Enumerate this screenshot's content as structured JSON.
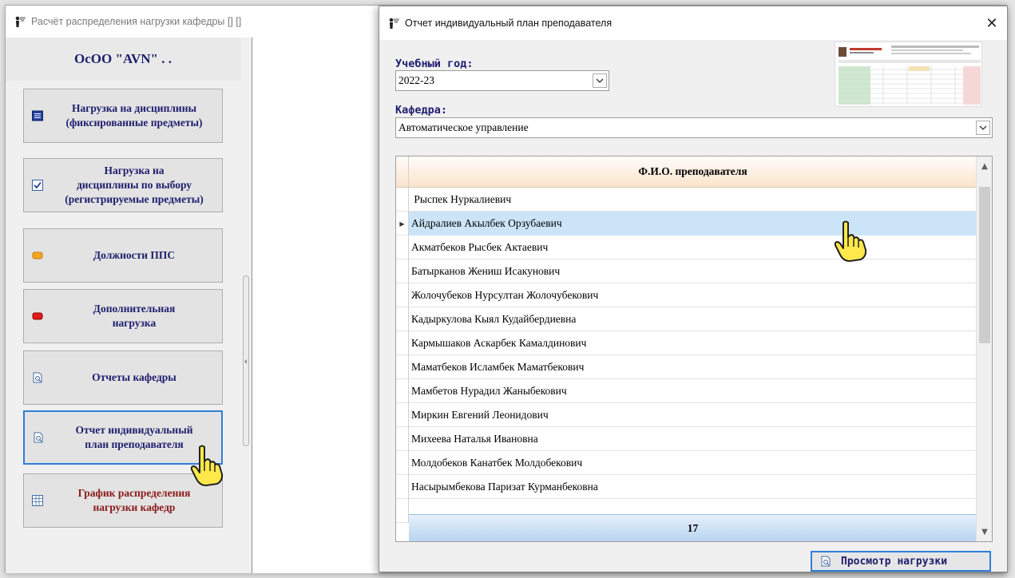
{
  "main_window": {
    "title": "Расчёт распределения нагрузки кафедры [] []",
    "org_name": "ОсОО \"AVN\" . .",
    "menu": [
      {
        "label": "Нагрузка на дисциплины\n(фиксированные предметы)",
        "icon": "list-icon",
        "color": "blue"
      },
      {
        "label": "Нагрузка на\nдисциплины по выбору\n(регистрируемые предметы)",
        "icon": "checkbox-icon",
        "color": "blue"
      },
      {
        "label": "Должности ППС",
        "icon": "orange-badge-icon",
        "color": "blue"
      },
      {
        "label": "Дополнительная\nнагрузка",
        "icon": "red-badge-icon",
        "color": "blue"
      },
      {
        "label": "Отчеты кафедры",
        "icon": "report-icon",
        "color": "blue"
      },
      {
        "label": "Отчет индивидуальный\nплан преподавателя",
        "icon": "report-icon",
        "color": "blue",
        "active": true
      },
      {
        "label": "График распределения\nнагрузки кафедр",
        "icon": "schedule-icon",
        "color": "red"
      }
    ],
    "splitter_glyph": "‹"
  },
  "dialog": {
    "title": "Отчет индивидуальный план преподавателя",
    "close_glyph": "✕",
    "year_label": "Учебный год:",
    "year_value": "2022-23",
    "dept_label": "Кафедра:",
    "dept_value": "Автоматическое управление",
    "grid_header": "Ф.И.О. преподавателя",
    "rows": [
      " Рыспек Нуркалиевич",
      "Айдралиев Акылбек Орзубаевич",
      "Акматбеков Рысбек Актаевич",
      "Батырканов Жениш Исакунович",
      "Жолочубеков Нурсултан Жолочубекович",
      "Кадыркулова Кыял Кудайбердиевна",
      "Кармышаков Аскарбек Камалдинович",
      "Маматбеков Исламбек Маматбекович",
      "Мамбетов Нурадил Жаныбекович",
      "Миркин Евгений Леонидович",
      "Михеева Наталья Ивановна",
      "Молдобеков Канатбек Молдобекович",
      "Насырымбекова Паризат Курманбековна",
      ""
    ],
    "selected_row_marker": "▶",
    "footer_count": "17",
    "view_button": "Просмотр нагрузки"
  },
  "colors": {
    "accent": "#2f7ed8",
    "menu_text": "#1d1d6e",
    "menu_text_red": "#8b1a1a",
    "selected_row": "#cce4f7"
  }
}
